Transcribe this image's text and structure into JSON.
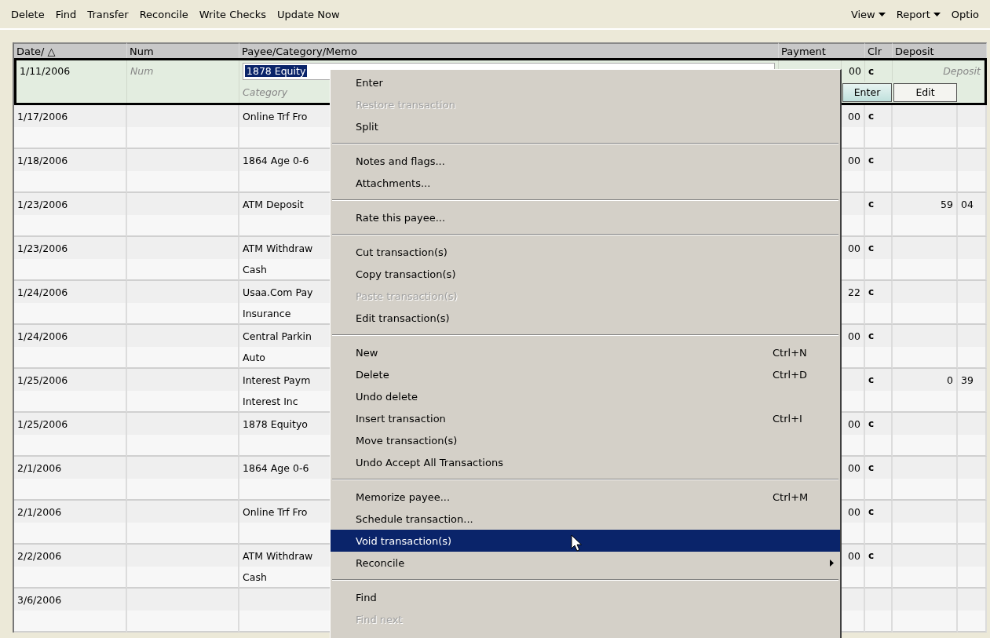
{
  "toolbar": {
    "left": [
      {
        "label": "Delete"
      },
      {
        "label": "Find"
      },
      {
        "label": "Transfer"
      },
      {
        "label": "Reconcile"
      },
      {
        "label": "Write Checks"
      },
      {
        "label": "Update Now"
      }
    ],
    "right": [
      {
        "label": "View",
        "dropdown": true
      },
      {
        "label": "Report",
        "dropdown": true
      },
      {
        "label": "Optio",
        "dropdown": false
      }
    ]
  },
  "register": {
    "columns": [
      "Date/ △",
      "Num",
      "Payee/Category/Memo",
      "Payment",
      "Clr",
      "Deposit"
    ],
    "edit_row": {
      "date": "1/11/2006",
      "num_placeholder": "Num",
      "payee": "1878 Equity",
      "category_placeholder": "Category",
      "payment": "00",
      "clr": "c",
      "deposit_placeholder": "Deposit",
      "buttons": [
        {
          "label": "Enter",
          "selected": true
        },
        {
          "label": "Edit",
          "selected": false
        }
      ]
    },
    "rows": [
      {
        "date": "1/17/2006",
        "payee": "Online Trf Fro",
        "payment": "00",
        "clr": "c"
      },
      {
        "date": "1/18/2006",
        "payee": "1864  Age 0-6",
        "payment": "00",
        "clr": "c"
      },
      {
        "date": "1/23/2006",
        "payee": "ATM Deposit",
        "clr": "c",
        "deposit": "59",
        "deposit_cents": "04"
      },
      {
        "date": "1/23/2006",
        "payee": "ATM Withdraw",
        "category": "Cash",
        "payment": "00",
        "clr": "c"
      },
      {
        "date": "1/24/2006",
        "payee": "Usaa.Com Pay",
        "category": "Insurance",
        "payment": "22",
        "clr": "c"
      },
      {
        "date": "1/24/2006",
        "payee": "Central Parkin",
        "category": "Auto",
        "payment": "00",
        "clr": "c"
      },
      {
        "date": "1/25/2006",
        "payee": "Interest Paym",
        "category": "Interest Inc",
        "clr": "c",
        "deposit": "0",
        "deposit_cents": "39"
      },
      {
        "date": "1/25/2006",
        "payee": "1878  Equityo",
        "payment": "00",
        "clr": "c"
      },
      {
        "date": "2/1/2006",
        "payee": "1864  Age 0-6",
        "payment": "00",
        "clr": "c"
      },
      {
        "date": "2/1/2006",
        "payee": "Online Trf Fro",
        "payment": "00",
        "clr": "c"
      },
      {
        "date": "2/2/2006",
        "payee": "ATM Withdraw",
        "category": "Cash",
        "payment": "00",
        "clr": "c"
      },
      {
        "date": "3/6/2006"
      }
    ]
  },
  "context_menu": {
    "items": [
      {
        "kind": "item",
        "label": "Enter",
        "disabled": false,
        "selected": false,
        "submenu": false
      },
      {
        "kind": "item",
        "label": "Restore transaction",
        "disabled": true,
        "selected": false,
        "submenu": false
      },
      {
        "kind": "item",
        "label": "Split",
        "disabled": false,
        "selected": false,
        "submenu": false
      },
      {
        "kind": "separator"
      },
      {
        "kind": "item",
        "label": "Notes and flags...",
        "disabled": false,
        "selected": false,
        "submenu": false
      },
      {
        "kind": "item",
        "label": "Attachments...",
        "disabled": false,
        "selected": false,
        "submenu": false
      },
      {
        "kind": "separator"
      },
      {
        "kind": "item",
        "label": "Rate this payee...",
        "disabled": false,
        "selected": false,
        "submenu": false
      },
      {
        "kind": "separator"
      },
      {
        "kind": "item",
        "label": "Cut transaction(s)",
        "disabled": false,
        "selected": false,
        "submenu": false
      },
      {
        "kind": "item",
        "label": "Copy transaction(s)",
        "disabled": false,
        "selected": false,
        "submenu": false
      },
      {
        "kind": "item",
        "label": "Paste transaction(s)",
        "disabled": true,
        "selected": false,
        "submenu": false
      },
      {
        "kind": "item",
        "label": "Edit transaction(s)",
        "disabled": false,
        "selected": false,
        "submenu": false
      },
      {
        "kind": "separator"
      },
      {
        "kind": "item",
        "label": "New",
        "shortcut": "Ctrl+N",
        "disabled": false,
        "selected": false,
        "submenu": false
      },
      {
        "kind": "item",
        "label": "Delete",
        "shortcut": "Ctrl+D",
        "disabled": false,
        "selected": false,
        "submenu": false
      },
      {
        "kind": "item",
        "label": "Undo delete",
        "disabled": false,
        "selected": false,
        "submenu": false
      },
      {
        "kind": "item",
        "label": "Insert transaction",
        "shortcut": "Ctrl+I",
        "disabled": false,
        "selected": false,
        "submenu": false
      },
      {
        "kind": "item",
        "label": "Move transaction(s)",
        "disabled": false,
        "selected": false,
        "submenu": false
      },
      {
        "kind": "item",
        "label": "Undo Accept All Transactions",
        "disabled": false,
        "selected": false,
        "submenu": false
      },
      {
        "kind": "separator"
      },
      {
        "kind": "item",
        "label": "Memorize payee...",
        "shortcut": "Ctrl+M",
        "disabled": false,
        "selected": false,
        "submenu": false
      },
      {
        "kind": "item",
        "label": "Schedule transaction...",
        "disabled": false,
        "selected": false,
        "submenu": false
      },
      {
        "kind": "item",
        "label": "Void transaction(s)",
        "disabled": false,
        "selected": true,
        "submenu": false
      },
      {
        "kind": "item",
        "label": "Reconcile",
        "disabled": false,
        "selected": false,
        "submenu": true
      },
      {
        "kind": "separator"
      },
      {
        "kind": "item",
        "label": "Find",
        "disabled": false,
        "selected": false,
        "submenu": false
      },
      {
        "kind": "item",
        "label": "Find next",
        "disabled": true,
        "selected": false,
        "submenu": false
      }
    ]
  }
}
